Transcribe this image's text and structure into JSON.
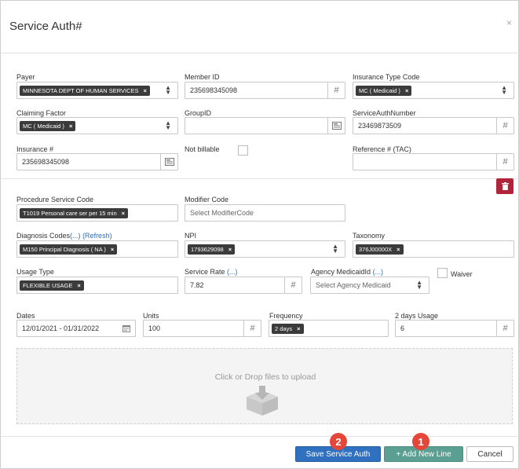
{
  "modal": {
    "title": "Service Auth#",
    "close_glyph": "×"
  },
  "labels": {
    "payer": "Payer",
    "member_id": "Member ID",
    "insurance_type_code": "Insurance Type Code",
    "claiming_factor": "Claiming Factor",
    "group_id": "GroupID",
    "service_auth_number": "ServiceAuthNumber",
    "insurance_no": "Insurance #",
    "not_billable": "Not billable",
    "reference_tac": "Reference # (TAC)",
    "procedure_service_code": "Procedure Service Code",
    "modifier_code": "Modifier Code",
    "diagnosis_codes": "Diagnosis Codes",
    "diagnosis_more": "(...)",
    "diagnosis_refresh": "(Refresh)",
    "npi": "NPI",
    "taxonomy": "Taxonomy",
    "usage_type": "Usage Type",
    "service_rate": "Service Rate",
    "service_rate_more": "(...)",
    "agency_medicaid_id": "Agency MedicaidId",
    "agency_more": "(...)",
    "waiver": "Waiver",
    "dates": "Dates",
    "units": "Units",
    "frequency": "Frequency",
    "usage_2_days": "2 days Usage"
  },
  "values": {
    "payer": "MINNESOTA DEPT OF HUMAN SERVICES",
    "member_id": "235698345098",
    "insurance_type_code": "MC ( Medicaid )",
    "claiming_factor": "MC ( Medicaid )",
    "group_id": "",
    "service_auth_number": "23469873509",
    "insurance_no": "235698345098",
    "reference_tac": "",
    "procedure_service_code": "T1019 Personal care ser per 15 min",
    "modifier_code_placeholder": "Select ModifierCode",
    "diagnosis_code": "M150 Principal Diagnosis ( NA )",
    "npi": "1793629098",
    "taxonomy": "376J00000X",
    "usage_type": "FLEXIBLE USAGE",
    "service_rate": "7.82",
    "agency_medicaid_placeholder": "Select Agency Medicaid",
    "dates": "12/01/2021 - 01/31/2022",
    "units": "100",
    "frequency": "2 days",
    "usage_2_days": "6"
  },
  "tag_remove_glyph": "×",
  "hash_glyph": "#",
  "upload": {
    "message": "Click or Drop files to upload"
  },
  "buttons": {
    "save": "Save Service Auth",
    "add_line": "+ Add New Line",
    "cancel": "Cancel"
  },
  "badges": {
    "save": "2",
    "add_line": "1"
  },
  "colors": {
    "primary": "#2f70c0",
    "success": "#5b9f93",
    "danger": "#b0253a",
    "badge": "#e5463a"
  }
}
